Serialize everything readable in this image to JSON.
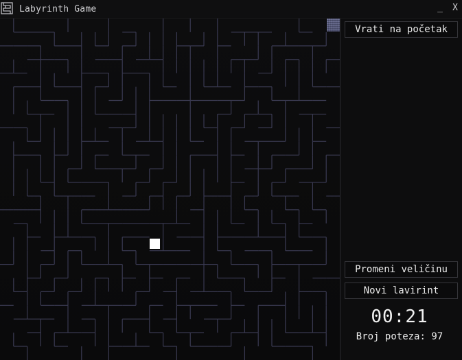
{
  "window": {
    "title": "Labyrinth Game",
    "minimize_label": "_",
    "close_label": "X"
  },
  "maze": {
    "wall_color": "#3a3a52",
    "background_color": "#0c0c0d",
    "player_color": "#ffffff",
    "goal_color": "#454864"
  },
  "panel": {
    "restart_label": "Vrati na početak",
    "resize_label": "Promeni veličinu",
    "new_maze_label": "Novi lavirint",
    "timer": "00:21",
    "moves_label": "Broj poteza:",
    "moves_count": "97"
  }
}
